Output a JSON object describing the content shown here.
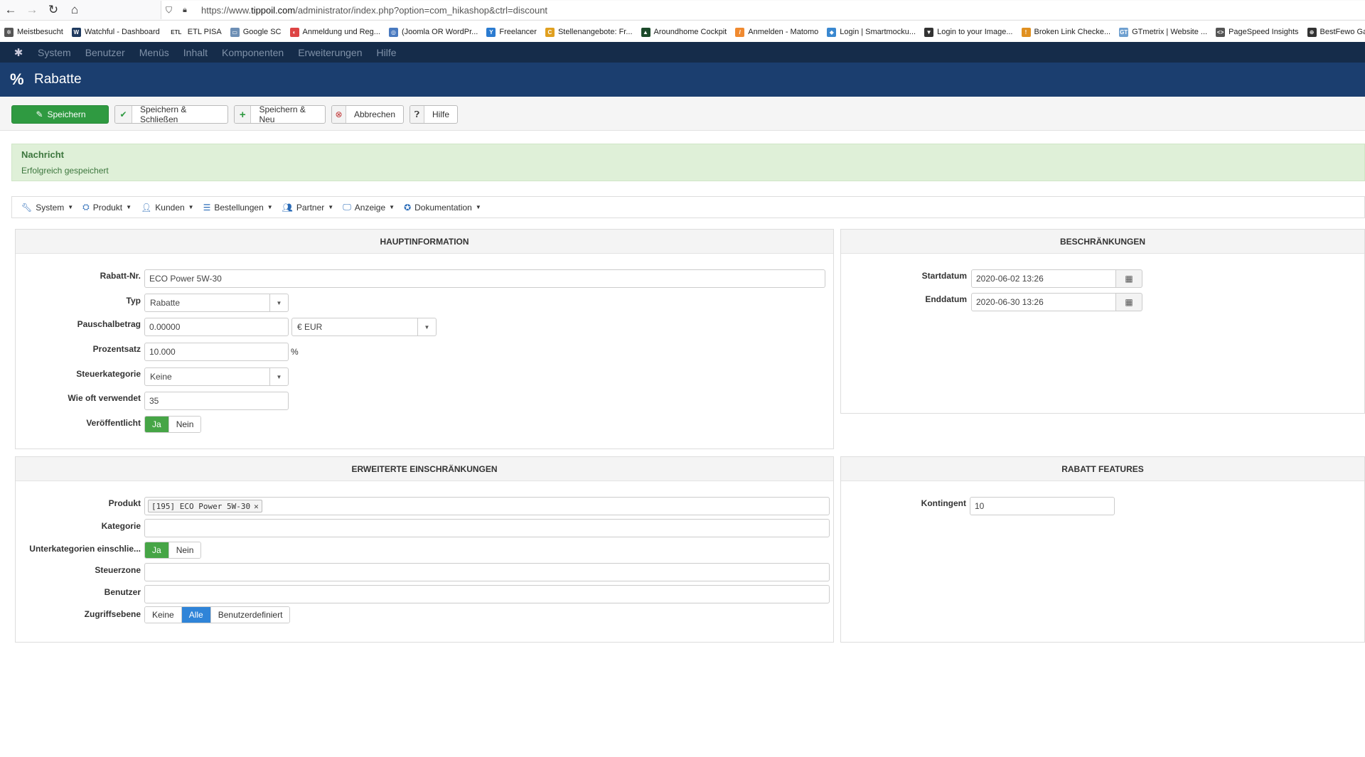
{
  "browser": {
    "url_prefix": "https://www.",
    "url_domain": "tippoil.com",
    "url_path": "/administrator/index.php?option=com_hikashop&ctrl=discount",
    "bookmarks": [
      {
        "label": "Meistbesucht",
        "color": "#555555",
        "glyph": "✲"
      },
      {
        "label": "Watchful - Dashboard",
        "color": "#1f3a5f",
        "glyph": "W"
      },
      {
        "label": "ETL PISA",
        "color": "#ffffff",
        "glyph": "ETL"
      },
      {
        "label": "Google SC",
        "color": "#6d8fb5",
        "glyph": "▭"
      },
      {
        "label": "Anmeldung und Reg...",
        "color": "#d44",
        "glyph": "◐"
      },
      {
        "label": "(Joomla OR WordPr...",
        "color": "#4a7ac0",
        "glyph": "◎"
      },
      {
        "label": "Freelancer",
        "color": "#2b7bd0",
        "glyph": "Y"
      },
      {
        "label": "Stellenangebote: Fr...",
        "color": "#e0a020",
        "glyph": "C"
      },
      {
        "label": "Aroundhome Cockpit",
        "color": "#1c4a2a",
        "glyph": "▲"
      },
      {
        "label": "Anmelden - Matomo",
        "color": "#f08a30",
        "glyph": "/"
      },
      {
        "label": "Login | Smartmocku...",
        "color": "#3a88d0",
        "glyph": "◆"
      },
      {
        "label": "Login to your Image...",
        "color": "#333333",
        "glyph": "▼"
      },
      {
        "label": "Broken Link Checke...",
        "color": "#e09020",
        "glyph": "!"
      },
      {
        "label": "GTmetrix | Website ...",
        "color": "#6fa0d0",
        "glyph": "GT"
      },
      {
        "label": "PageSpeed Insights",
        "color": "#555555",
        "glyph": "<>"
      },
      {
        "label": "BestFewo Gastgeber",
        "color": "#333333",
        "glyph": "⊕"
      }
    ]
  },
  "admin_nav": [
    "System",
    "Benutzer",
    "Menüs",
    "Inhalt",
    "Komponenten",
    "Erweiterungen",
    "Hilfe"
  ],
  "header": {
    "title": "Rabatte",
    "icon": "percent-icon"
  },
  "toolbar": {
    "save": "Speichern",
    "save_close": "Speichern & Schließen",
    "save_new": "Speichern & Neu",
    "cancel": "Abbrechen",
    "help": "Hilfe"
  },
  "message": {
    "title": "Nachricht",
    "text": "Erfolgreich gespeichert"
  },
  "submenu": [
    "System",
    "Produkt",
    "Kunden",
    "Bestellungen",
    "Partner",
    "Anzeige",
    "Dokumentation"
  ],
  "main_info": {
    "heading": "HAUPTINFORMATION",
    "code_label": "Rabatt-Nr.",
    "code_value": "ECO Power 5W-30",
    "type_label": "Typ",
    "type_value": "Rabatte",
    "flat_label": "Pauschalbetrag",
    "flat_value": "0.00000",
    "currency_value": "€ EUR",
    "percent_label": "Prozentsatz",
    "percent_value": "10.000",
    "percent_unit": "%",
    "tax_label": "Steuerkategorie",
    "tax_value": "Keine",
    "used_label": "Wie oft verwendet",
    "used_value": "35",
    "published_label": "Veröffentlicht",
    "yes": "Ja",
    "no": "Nein"
  },
  "restrictions": {
    "heading": "BESCHRÄNKUNGEN",
    "start_label": "Startdatum",
    "start_value": "2020-06-02 13:26",
    "end_label": "Enddatum",
    "end_value": "2020-06-30 13:26"
  },
  "advanced": {
    "heading": "ERWEITERTE EINSCHRÄNKUNGEN",
    "product_label": "Produkt",
    "product_tag": "[195] ECO Power 5W-30",
    "category_label": "Kategorie",
    "subcat_label": "Unterkategorien einschlie...",
    "yes": "Ja",
    "no": "Nein",
    "taxzone_label": "Steuerzone",
    "user_label": "Benutzer",
    "access_label": "Zugriffsebene",
    "access_options": [
      "Keine",
      "Alle",
      "Benutzerdefiniert"
    ]
  },
  "features": {
    "heading": "RABATT FEATURES",
    "quota_label": "Kontingent",
    "quota_value": "10"
  }
}
